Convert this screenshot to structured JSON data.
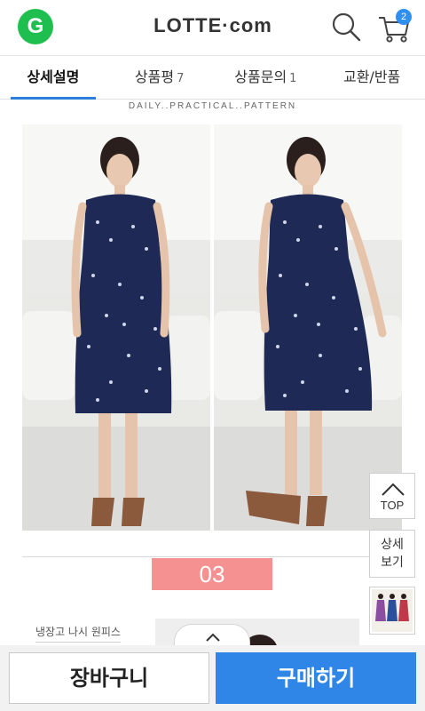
{
  "header": {
    "logo_letter": "G",
    "brand": "LOTTE·com",
    "cart_count": "2",
    "icons": [
      "g-logo-icon",
      "search-icon",
      "cart-icon"
    ]
  },
  "tabs": [
    {
      "label": "상세설명",
      "count": "",
      "active": true
    },
    {
      "label": "상품평",
      "count": "7",
      "active": false
    },
    {
      "label": "상품문의",
      "count": "1",
      "active": false
    },
    {
      "label": "교환/반품",
      "count": "",
      "active": false
    }
  ],
  "content": {
    "pattern_text": "DAILY..PRACTICAL..PATTERN",
    "section_number": "03",
    "sub_caption": "냉장고 나시 원피스"
  },
  "side": {
    "top_label": "TOP",
    "detail_label_line1": "상세",
    "detail_label_line2": "보기"
  },
  "bottom": {
    "cart_label": "장바구니",
    "buy_label": "구매하기"
  },
  "colors": {
    "accent": "#2f86e6",
    "tab_indicator": "#2b7fd8",
    "badge": "#2e8ff0",
    "section_number_bg": "#f59191",
    "g_logo": "#1fbf4f",
    "dress": "#1e2a55"
  }
}
